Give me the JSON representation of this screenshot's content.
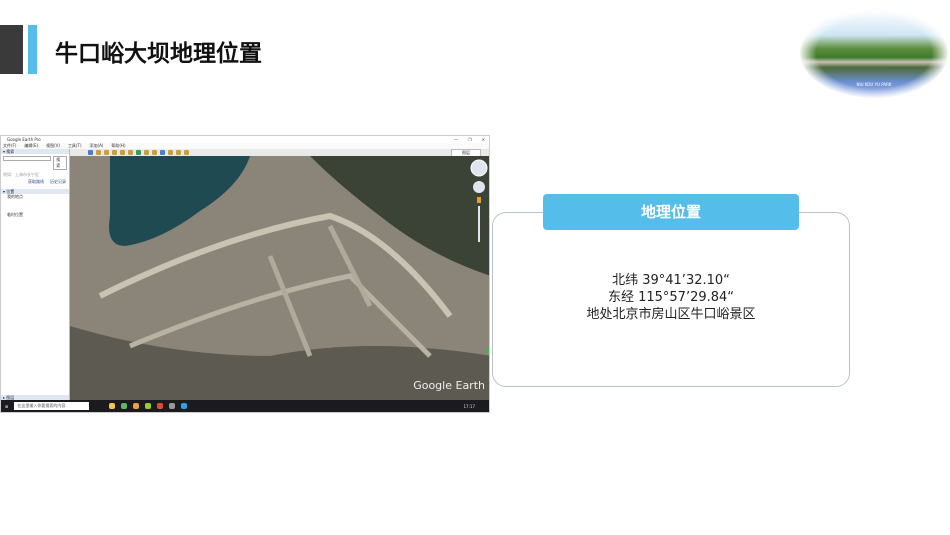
{
  "header": {
    "title": "牛口峪大坝地理位置"
  },
  "decor_image": {
    "caption": "NIU KOU YU PARK"
  },
  "google_earth": {
    "window_title": "Google Earth Pro",
    "window_buttons": [
      "—",
      "❐",
      "✕"
    ],
    "menu": [
      "文件(F)",
      "编辑(E)",
      "视图(V)",
      "工具(T)",
      "添加(A)",
      "帮助(H)"
    ],
    "search": {
      "header": "▾ 搜索",
      "button": "搜索",
      "hint": "例如：上海市长宁区",
      "links": [
        "获取路线",
        "历史记录"
      ]
    },
    "places": {
      "header": "▾ 位置",
      "items": [
        "我的地点",
        "临时位置"
      ]
    },
    "layers_header": "▸ 图层",
    "right_panel_button": "图层",
    "watermark": "Google Earth",
    "taskbar": {
      "search_placeholder": "在这里输入你要搜索的内容",
      "time": "17:17"
    }
  },
  "info_card": {
    "title": "地理位置",
    "latitude": "北纬 39°41’32.10“",
    "longitude": "东经 115°57’29.84“",
    "location": "地处北京市房山区牛口峪景区"
  }
}
